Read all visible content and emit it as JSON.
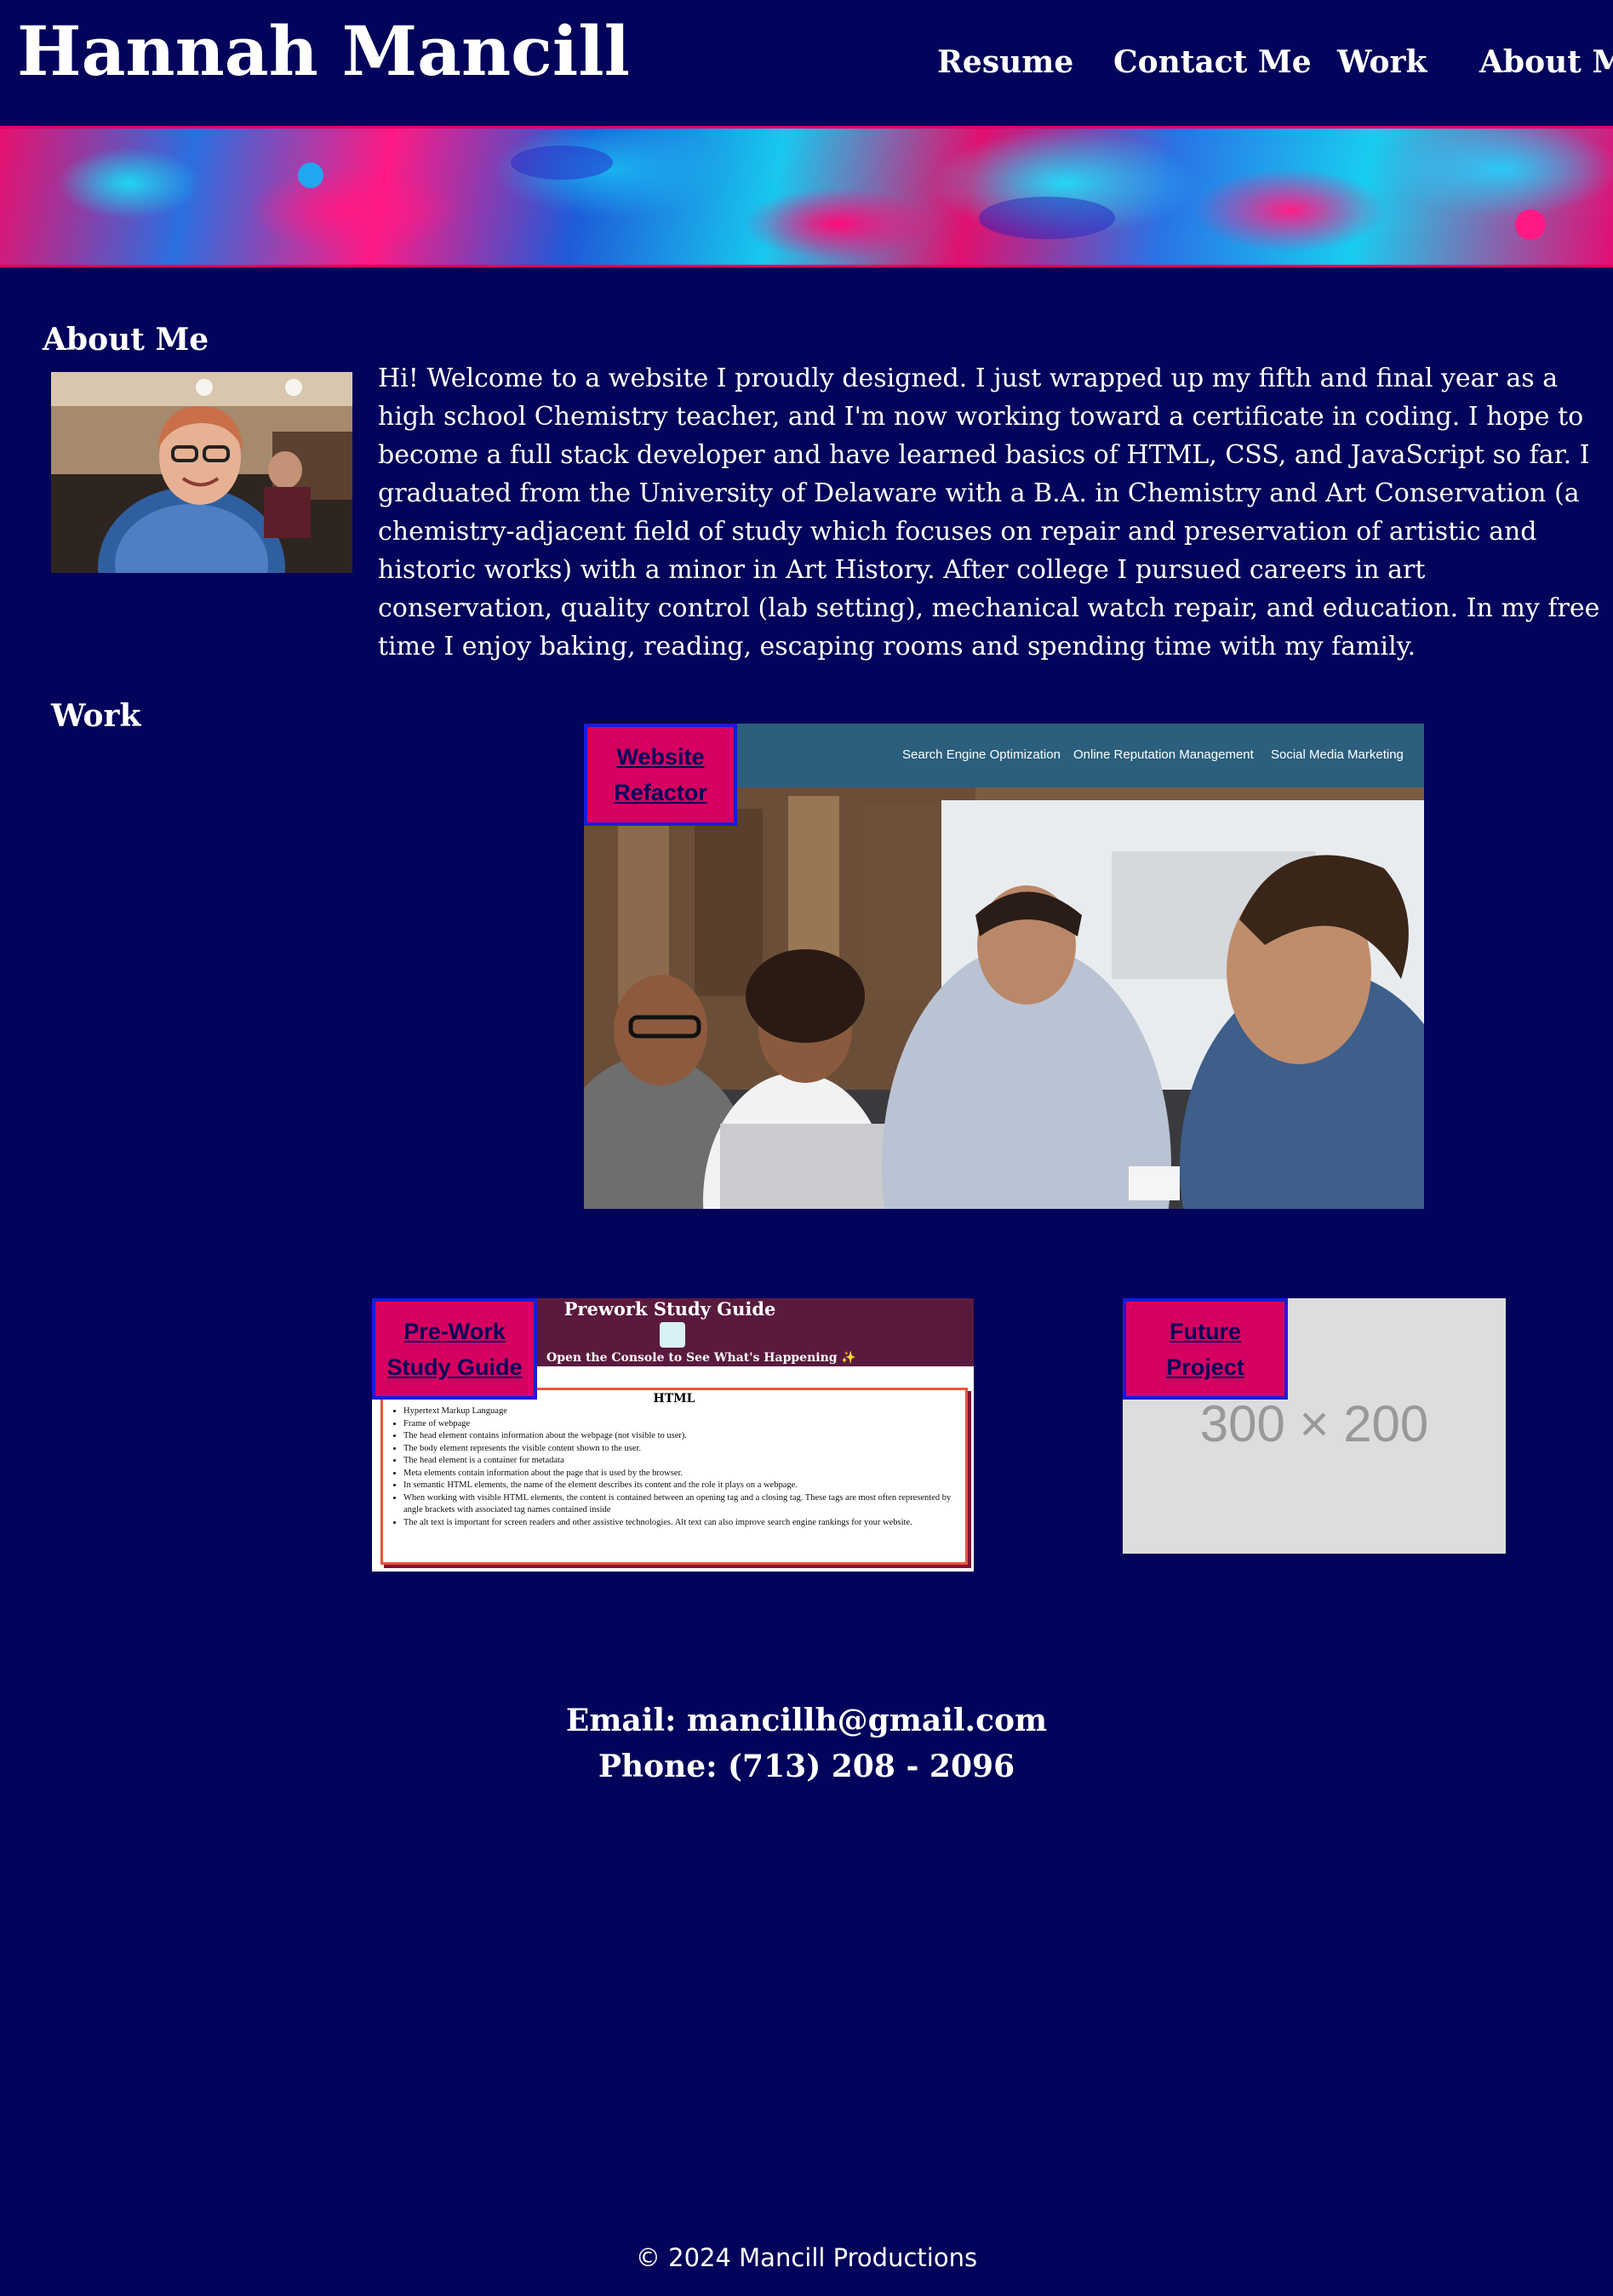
{
  "header": {
    "title": "Hannah Mancill",
    "nav": [
      {
        "label": "Resume"
      },
      {
        "label": "Contact Me"
      },
      {
        "label": "Work"
      },
      {
        "label": "About Me"
      }
    ]
  },
  "about": {
    "heading": "About Me",
    "text": "Hi! Welcome to a website I proudly designed. I just wrapped up my fifth and final year as a high school Chemistry teacher, and I'm now working toward a certificate in coding. I hope to become a full stack developer and have learned basics of HTML, CSS, and JavaScript so far. I graduated from the University of Delaware with a B.A. in Chemistry and Art Conservation (a chemistry-adjacent field of study which focuses on repair and preservation of artistic and historic works) with a minor in Art History. After college I pursued careers in art conservation, quality control (lab setting), mechanical watch repair, and education. In my free time I enjoy baking, reading, escaping rooms and spending time with my family."
  },
  "work": {
    "heading": "Work",
    "projects": [
      {
        "label_line1": "Website",
        "label_line2": "Refactor",
        "screenshot_nav": [
          "Search Engine Optimization",
          "Online Reputation Management",
          "Social Media Marketing"
        ]
      },
      {
        "label_line1": "Pre-Work",
        "label_line2": "Study Guide",
        "screenshot": {
          "title": "Prework Study Guide",
          "subtitle": "Open the Console to See What's Happening ✨",
          "section_title": "HTML",
          "bullets": [
            "Hypertext Markup Language",
            "Frame of webpage",
            "The head element contains information about the webpage (not visible to user).",
            "The body element represents the visible content shown to the user.",
            "The head element is a container for metadata",
            "Meta elements contain information about the page that is used by the browser.",
            "In semantic HTML elements, the name of the element describes its content and the role it plays on a webpage.",
            "When working with visible HTML elements, the content is contained between an opening tag and a closing tag. These tags are most often represented by angle brackets with associated tag names contained inside",
            "The alt text is important for screen readers and other assistive technologies. Alt text can also improve search engine rankings for your website."
          ]
        }
      },
      {
        "label_line1": "Future",
        "label_line2": "Project",
        "placeholder": "300 × 200"
      }
    ]
  },
  "contact": {
    "email": "Email: mancillh@gmail.com",
    "phone": "Phone: (713) 208 - 2096"
  },
  "footer": {
    "text": "© 2024 Mancill Productions"
  },
  "colors": {
    "background": "#02035a",
    "accent": "#d5005f",
    "label_border": "#1b1bdc"
  }
}
